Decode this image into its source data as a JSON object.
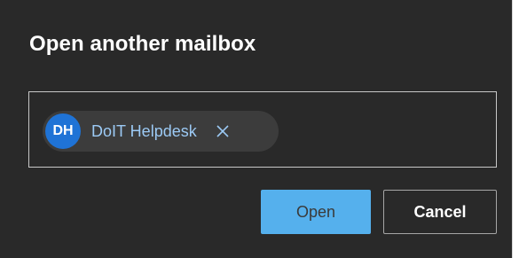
{
  "dialog": {
    "title": "Open another mailbox",
    "recipient": {
      "initials": "DH",
      "name": "DoIT Helpdesk",
      "remove_icon": "close-icon",
      "avatar_color": "#1f73d6",
      "name_color": "#9ccaf5"
    },
    "buttons": {
      "open_label": "Open",
      "cancel_label": "Cancel"
    },
    "colors": {
      "background": "#292929",
      "primary": "#55b0ed"
    }
  }
}
